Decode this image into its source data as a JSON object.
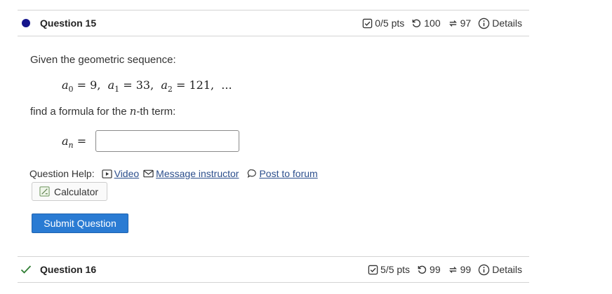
{
  "q15": {
    "title": "Question 15",
    "score": "0/5 pts",
    "attempts": "100",
    "retries": "97",
    "details": "Details",
    "prompt1": "Given the geometric sequence:",
    "sequence": {
      "a0_val": "9",
      "a1_val": "33",
      "a2_val": "121",
      "ellipsis": "..."
    },
    "prompt2_pre": "find a formula for the ",
    "prompt2_var": "n",
    "prompt2_post": "-th term:",
    "answer_value": "",
    "help_label": "Question Help:",
    "video": "Video",
    "message": "Message instructor",
    "forum": "Post to forum",
    "calculator": "Calculator",
    "submit": "Submit Question"
  },
  "q16": {
    "title": "Question 16",
    "score": "5/5 pts",
    "attempts": "99",
    "retries": "99",
    "details": "Details"
  },
  "colors": {
    "status_dot": "#15158c",
    "check": "#2e7d32",
    "link": "#2b4e8c",
    "submit": "#2a7bd3"
  }
}
